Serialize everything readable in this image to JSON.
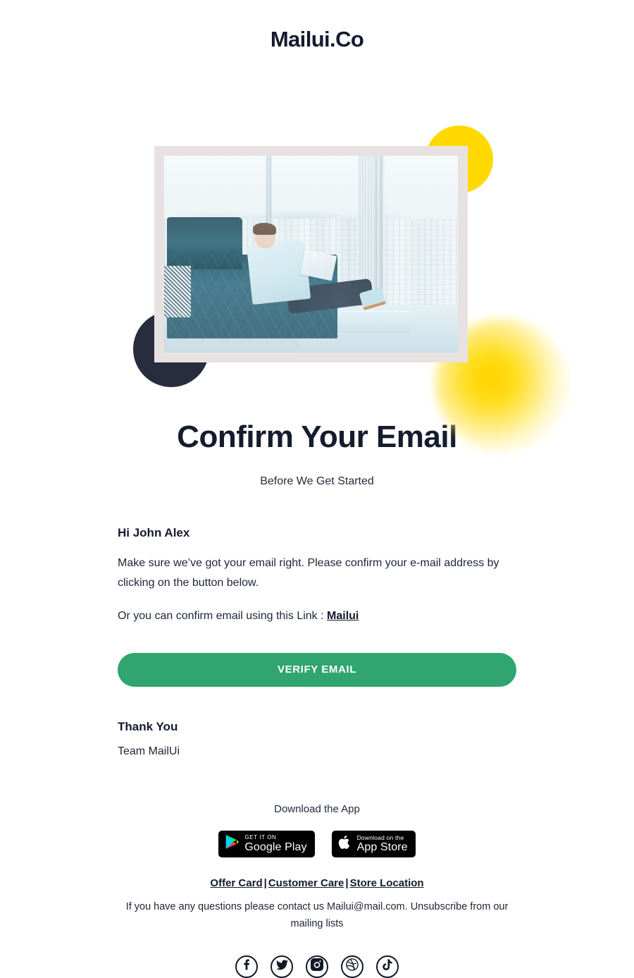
{
  "brand": {
    "logo_text": "Mailui.Co",
    "accent_green": "#30a56f",
    "dark_navy": "#151c2c",
    "yellow": "#ffd900"
  },
  "hero": {
    "image_alt": "Man sitting on a leather sofa working on a laptop beside a tall city-view window",
    "shapes": [
      "yellow-circle",
      "dark-circle",
      "yellow-glow"
    ]
  },
  "headline": "Confirm Your Email",
  "subhead": "Before We Get Started",
  "body": {
    "greeting": "Hi John Alex",
    "paragraph": "Make sure we’ve got your email right. Please confirm your e-mail address by clicking on the button below.",
    "link_lead": "Or you can confirm email using this Link :",
    "link_text": "Mailui"
  },
  "cta": {
    "verify_label": "VERIFY EMAIL"
  },
  "signoff": {
    "thanks": "Thank You",
    "team": "Team MailUi"
  },
  "footer": {
    "download_label": "Download the App",
    "badges": [
      {
        "id": "google-play",
        "small": "GET IT ON",
        "big": "Google Play"
      },
      {
        "id": "app-store",
        "small": "Download on the",
        "big": "App Store"
      }
    ],
    "links": [
      {
        "label": "Offer Card"
      },
      {
        "label": "Customer Care"
      },
      {
        "label": "Store Location"
      }
    ],
    "separator": "|",
    "fine_print": "If you have any questions please contact us Mailui@mail.com. Unsubscribe from our mailing lists",
    "socials": [
      "facebook-icon",
      "twitter-icon",
      "instagram-icon",
      "dribbble-icon",
      "tiktok-icon"
    ]
  }
}
